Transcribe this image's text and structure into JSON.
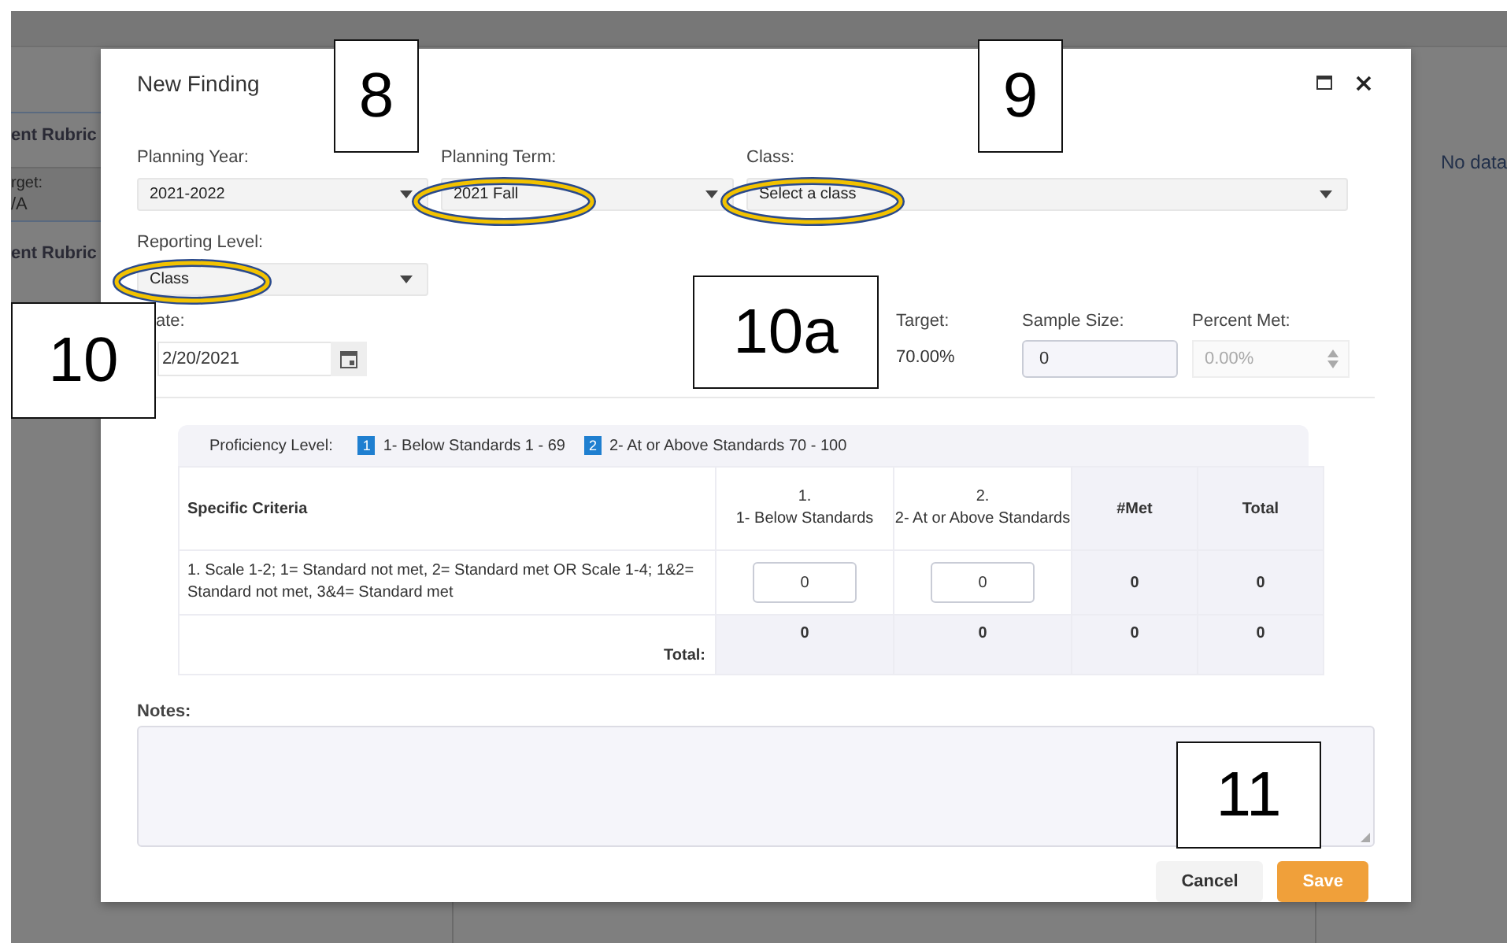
{
  "background": {
    "left_panel": [
      {
        "kind": "title",
        "text": "ent Rubric"
      },
      {
        "kind": "label",
        "text": "rget:"
      },
      {
        "kind": "value",
        "text": "/A"
      },
      {
        "kind": "title",
        "text": "ent Rubric"
      }
    ],
    "right_panel": {
      "message": "No data"
    }
  },
  "dialog": {
    "title": "New Finding",
    "planning_year": {
      "label": "Planning Year:",
      "value": "2021-2022"
    },
    "planning_term": {
      "label": "Planning Term:",
      "value": "2021 Fall"
    },
    "class": {
      "label": "Class:",
      "placeholder": "Select a class"
    },
    "reporting_level": {
      "label": "Reporting Level:",
      "value": "Class"
    },
    "date": {
      "label": "ate:",
      "value": "2/20/2021"
    },
    "target": {
      "label": "Target:",
      "value": "70.00%"
    },
    "sample_size": {
      "label": "Sample Size:",
      "value": "0"
    },
    "percent_met": {
      "label": "Percent Met:",
      "value": "0.00%",
      "disabled": true
    },
    "proficiency": {
      "label": "Proficiency Level:",
      "levels": [
        {
          "number": "1",
          "text": "1- Below Standards 1 - 69"
        },
        {
          "number": "2",
          "text": "2- At or Above Standards 70 - 100"
        }
      ]
    },
    "table": {
      "columns": [
        {
          "kind": "criteria",
          "name": "Specific Criteria"
        },
        {
          "kind": "level",
          "number": "1.",
          "name": "1- Below Standards"
        },
        {
          "kind": "level",
          "number": "2.",
          "name": "2- At or Above Standards"
        },
        {
          "kind": "summary",
          "name": "#Met"
        },
        {
          "kind": "summary",
          "name": "Total"
        }
      ],
      "rows": [
        {
          "criteria": "1. Scale 1-2; 1= Standard not met, 2= Standard met OR Scale 1-4; 1&2= Standard not met, 3&4= Standard met",
          "inputs": [
            "0",
            "0"
          ],
          "met": "0",
          "total": "0"
        }
      ],
      "total_row": {
        "label": "Total:",
        "values": [
          "0",
          "0",
          "0",
          "0"
        ]
      }
    },
    "notes": {
      "label": "Notes:"
    },
    "buttons": [
      {
        "kind": "secondary",
        "label": "Cancel"
      },
      {
        "kind": "primary",
        "label": "Save"
      }
    ]
  },
  "callouts": [
    "8",
    "9",
    "10",
    "10a",
    "11"
  ]
}
